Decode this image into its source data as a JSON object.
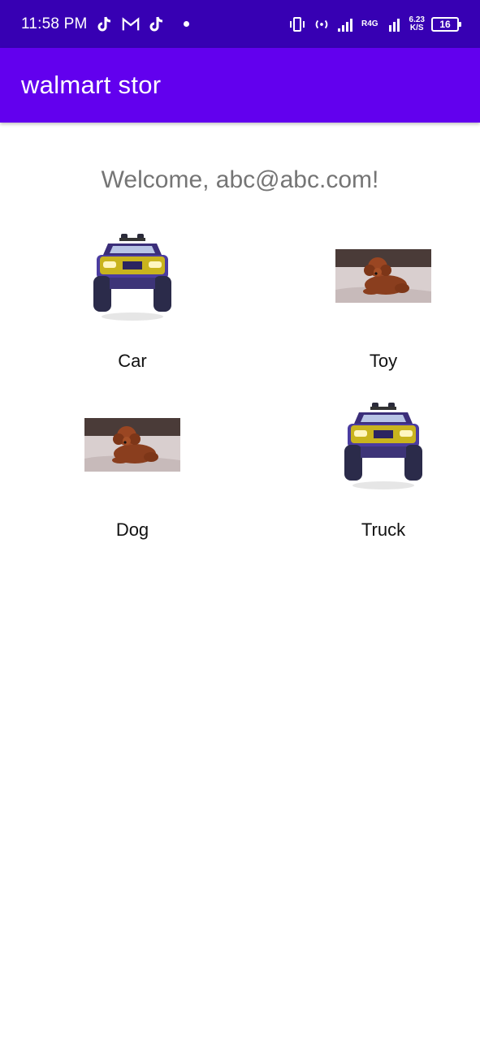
{
  "status_bar": {
    "time": "11:58 PM",
    "network_top": "R4G",
    "speed_top": "6.23",
    "speed_bottom": "K/S",
    "battery": "16"
  },
  "app_bar": {
    "title": "walmart stor"
  },
  "welcome": {
    "text": "Welcome, abc@abc.com!"
  },
  "products": [
    {
      "label": "Car",
      "image": "toy-car-image"
    },
    {
      "label": "Toy",
      "image": "dog-image"
    },
    {
      "label": "Dog",
      "image": "dog-image"
    },
    {
      "label": "Truck",
      "image": "toy-car-image"
    }
  ],
  "colors": {
    "status_bar": "#3700b3",
    "app_bar": "#6200ee",
    "welcome_text": "#757575"
  }
}
